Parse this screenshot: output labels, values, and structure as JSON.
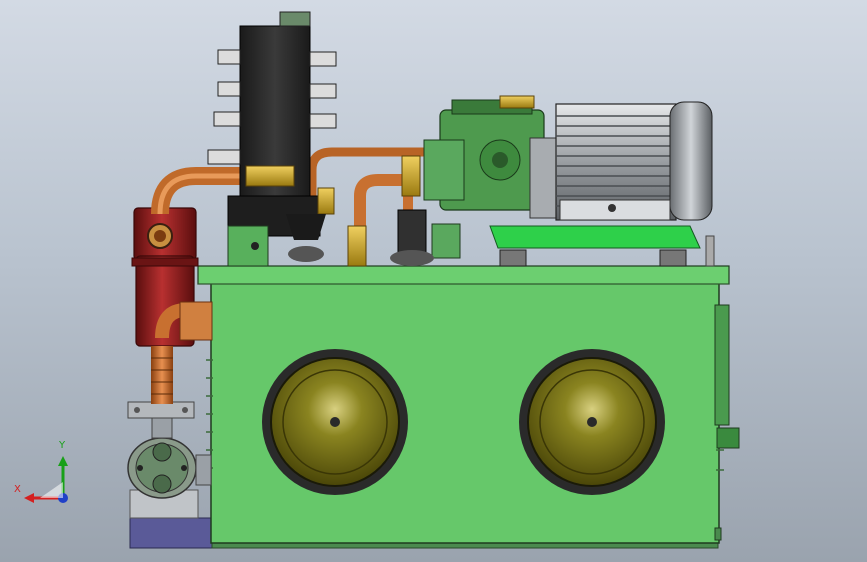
{
  "viewport": {
    "background_top": "#d3dae4",
    "background_bottom": "#9aa3ae"
  },
  "triad": {
    "x_label": "X",
    "y_label": "Y",
    "x_color": "#d42020",
    "y_color": "#18a018",
    "z_color": "#2040c8"
  },
  "model": {
    "tank_color": "#66c86a",
    "base_color": "#5a5a98",
    "filter_color": "#8b1c1c",
    "pipe_color": "#c87030",
    "valve_block_color": "#2a2a2a",
    "motor_color": "#b4b8bc",
    "pump_color": "#4e9a4e",
    "sight_glass_color": "#6e6a10",
    "icons": [
      "hydraulic-tank",
      "electric-motor",
      "gear-pump",
      "return-filter",
      "valve-manifold",
      "suction-pump",
      "inspection-cover"
    ]
  }
}
